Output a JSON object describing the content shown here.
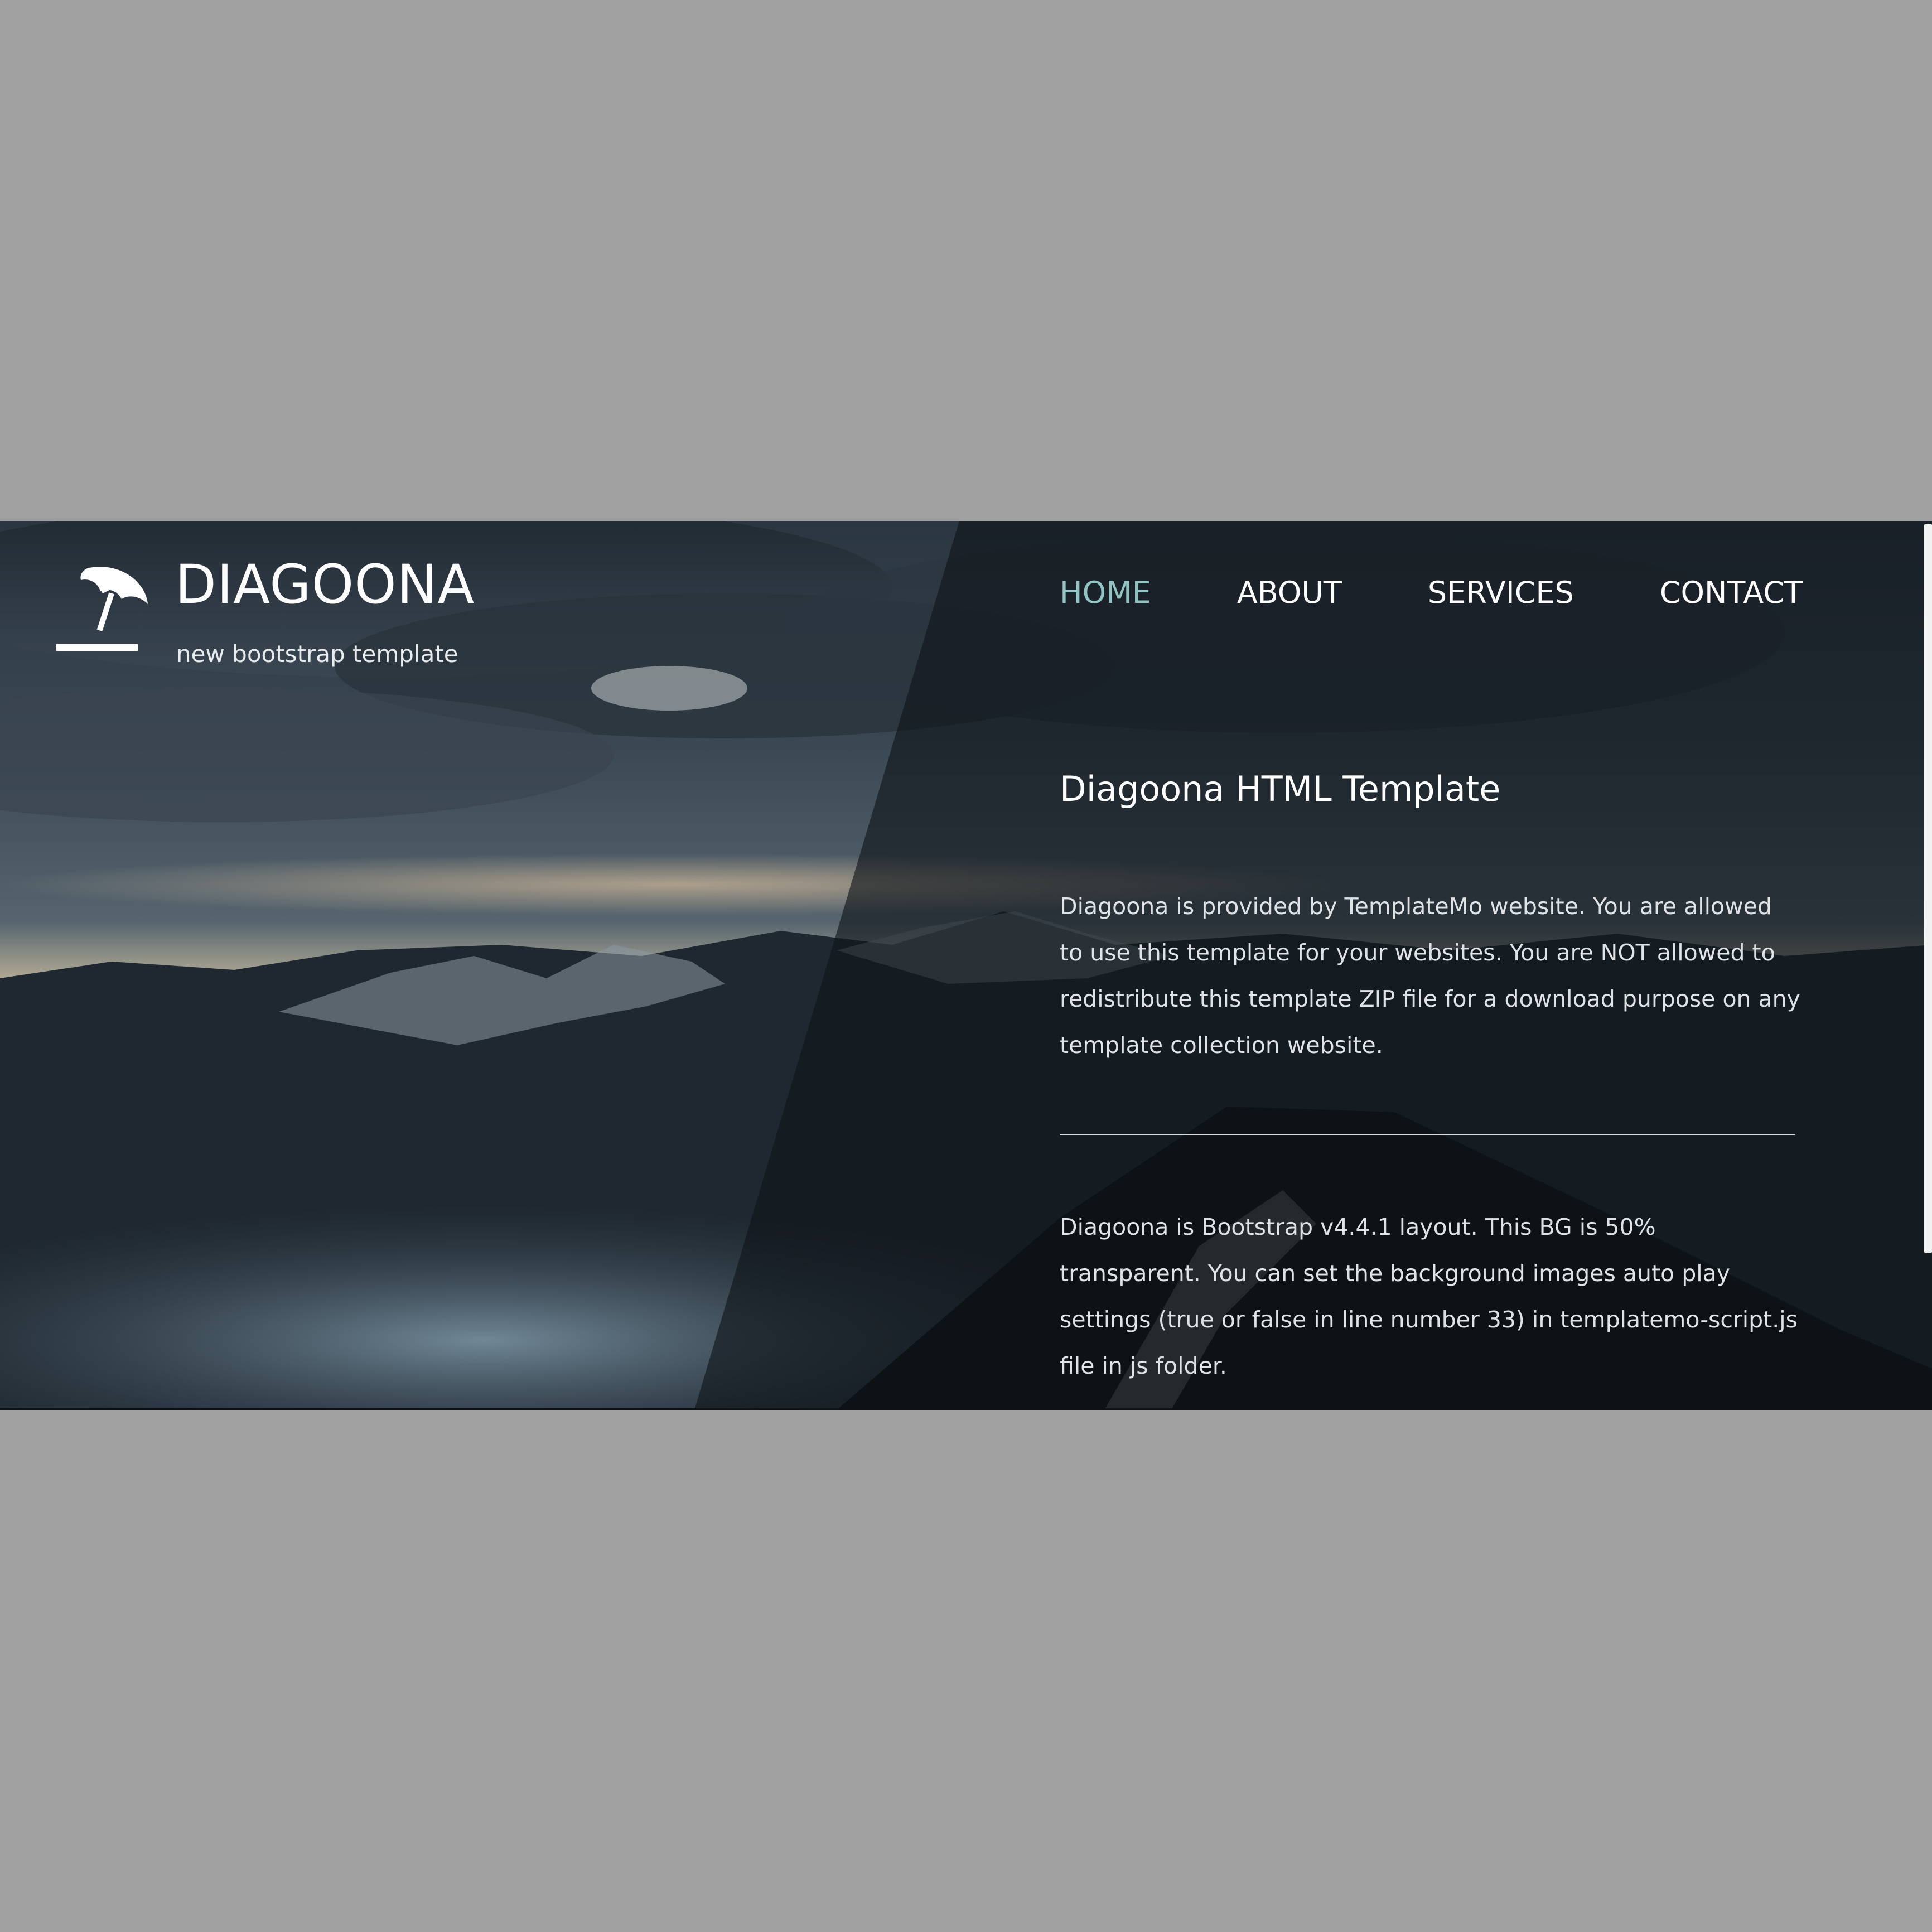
{
  "header": {
    "brand_title": "DIAGOONA",
    "brand_subtitle": "new bootstrap template",
    "logo_icon": "beach-umbrella-icon"
  },
  "nav": {
    "items": [
      {
        "label": "HOME",
        "active": true
      },
      {
        "label": "ABOUT",
        "active": false
      },
      {
        "label": "SERVICES",
        "active": false
      },
      {
        "label": "CONTACT",
        "active": false
      }
    ]
  },
  "main": {
    "heading": "Diagoona HTML Template",
    "paragraph_1": "Diagoona is provided by TemplateMo website. You are allowed to use this template for your websites. You are NOT allowed to redistribute this template ZIP file for a download purpose on any template collection website.",
    "paragraph_2": "Diagoona is Bootstrap v4.4.1 layout. This BG is 50% transparent. You can set the background images auto play settings (true or false in line number 33) in templatemo-script.js file in js folder."
  },
  "colors": {
    "page_outer": "#a0a0a0",
    "nav_active": "#90c5c4",
    "text_light": "#ffffff",
    "overlay_dark": "#0f1418"
  }
}
